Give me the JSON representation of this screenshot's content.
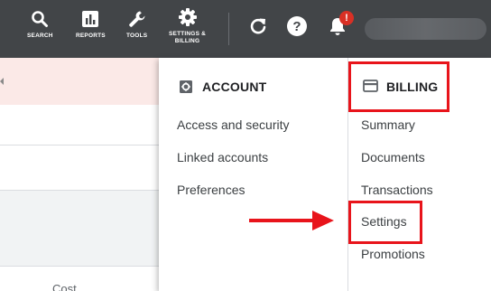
{
  "topbar": {
    "items": [
      {
        "label": "SEARCH",
        "icon": "search-icon"
      },
      {
        "label": "REPORTS",
        "icon": "reports-icon"
      },
      {
        "label": "TOOLS",
        "icon": "wrench-icon"
      },
      {
        "label": "SETTINGS &\nBILLING",
        "icon": "gear-icon"
      }
    ],
    "actions": [
      {
        "icon": "refresh-icon"
      },
      {
        "icon": "help-icon"
      },
      {
        "icon": "bell-icon"
      }
    ],
    "notification_badge": "!"
  },
  "background": {
    "cost_label": "Cost"
  },
  "menu": {
    "account": {
      "title": "ACCOUNT",
      "icon": "gear-square-icon",
      "items": [
        "Access and security",
        "Linked accounts",
        "Preferences"
      ]
    },
    "billing": {
      "title": "BILLING",
      "icon": "credit-card-icon",
      "items": [
        "Summary",
        "Documents",
        "Transactions",
        "Settings",
        "Promotions"
      ]
    }
  },
  "colors": {
    "topbar": "#424548",
    "highlight": "#e8141b",
    "badge": "#d93025",
    "alert_background": "#fbe9e7"
  }
}
